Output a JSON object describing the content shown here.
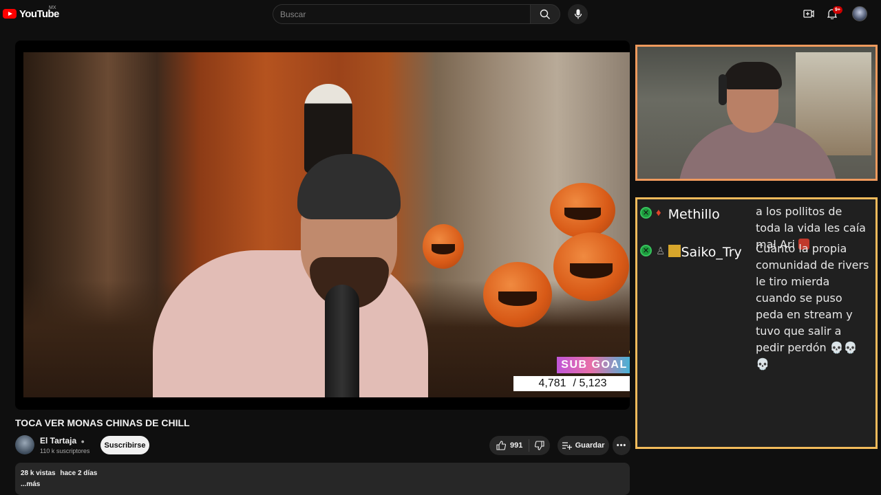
{
  "header": {
    "logo_text": "YouTube",
    "logo_region": "MX",
    "search_placeholder": "Buscar",
    "notification_count": "9+",
    "icons": [
      "search-icon",
      "mic-icon",
      "create-icon",
      "bell-icon",
      "avatar"
    ]
  },
  "video": {
    "overlay": {
      "goal_label": "SUB GOAL",
      "goal_current": "4,781",
      "goal_target": "/ 5,123"
    }
  },
  "chat": {
    "messages": [
      {
        "user": "Methillo",
        "text": "a los pollitos de toda la vida les caía mal Ari"
      },
      {
        "user": "Saiko_Try",
        "text": "Cuánto la propia comunidad de rivers le tiro mierda cuando se puso peda en stream y tuvo que salir a pedir perdón 💀💀💀"
      }
    ]
  },
  "info": {
    "title": "TOCA VER MONAS CHINAS DE CHILL",
    "channel_name": "El Tartaja",
    "channel_subs": "110 k suscriptores",
    "subscribe_label": "Suscribirse",
    "likes": "991",
    "save_label": "Guardar",
    "description": {
      "views": "28 k vistas",
      "date": "hace 2 días",
      "more": "...más"
    }
  },
  "colors": {
    "background": "#0f0f0f",
    "cam_border": "#ef9a5d",
    "chat_border": "#f3bb5b",
    "brand_red": "#ff0000"
  }
}
